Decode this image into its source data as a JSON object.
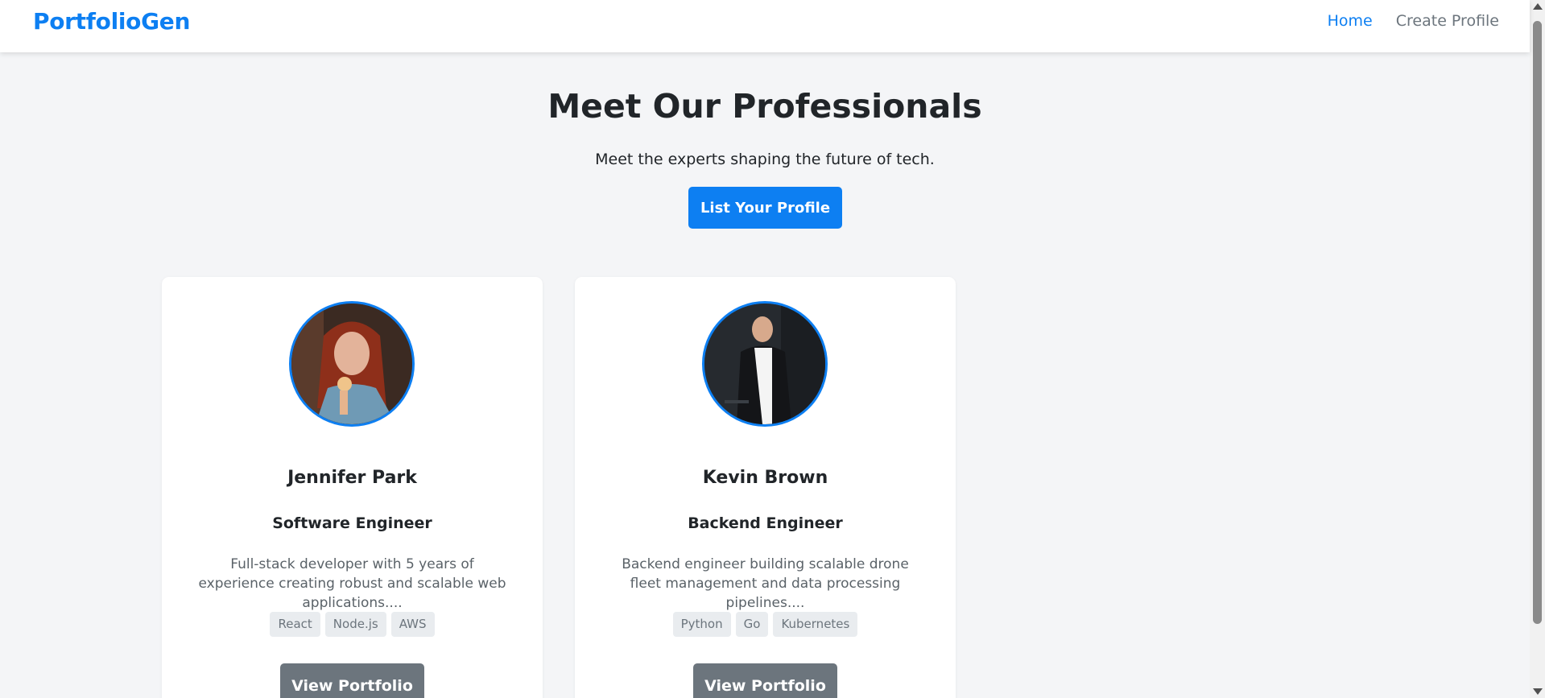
{
  "navbar": {
    "brand": "PortfolioGen",
    "links": [
      {
        "label": "Home",
        "active": true
      },
      {
        "label": "Create Profile",
        "active": false
      }
    ]
  },
  "hero": {
    "title": "Meet Our Professionals",
    "subtitle": "Meet the experts shaping the future of tech.",
    "cta_label": "List Your Profile"
  },
  "profiles": [
    {
      "name": "Jennifer Park",
      "role": "Software Engineer",
      "description": "Full-stack developer with 5 years of experience creating robust and scalable web applications....",
      "skills": [
        "React",
        "Node.js",
        "AWS"
      ],
      "button_label": "View Portfolio"
    },
    {
      "name": "Kevin Brown",
      "role": "Backend Engineer",
      "description": "Backend engineer building scalable drone fleet management and data processing pipelines....",
      "skills": [
        "Python",
        "Go",
        "Kubernetes"
      ],
      "button_label": "View Portfolio"
    }
  ],
  "colors": {
    "accent": "#0d7ff2",
    "secondary_button": "#6c757d",
    "page_background": "#f4f5f7"
  }
}
